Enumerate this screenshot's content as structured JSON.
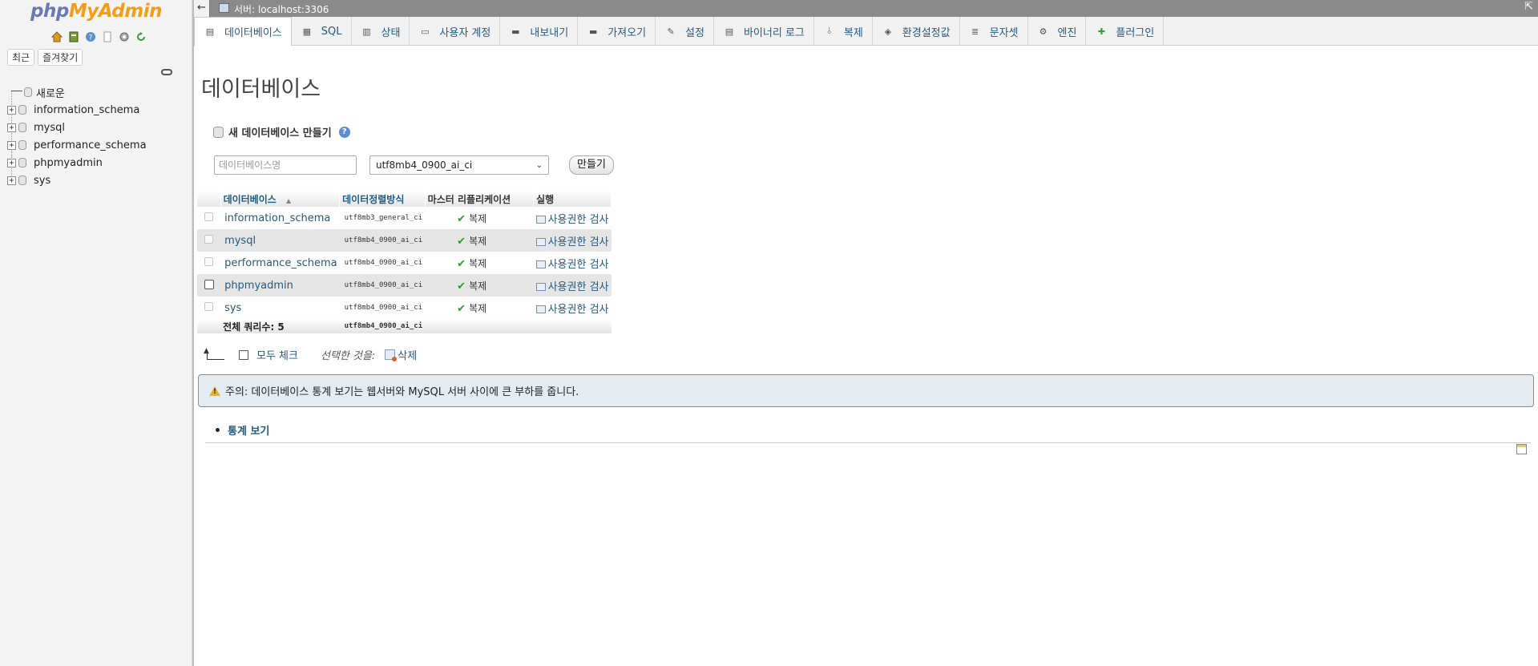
{
  "sidebar": {
    "logo": {
      "php": "php",
      "myadmin": "MyAdmin"
    },
    "nav_icons": [
      "home-icon",
      "database-icon",
      "help-icon",
      "docs-icon",
      "settings-icon",
      "reload-icon"
    ],
    "tabs": {
      "recent": "최근",
      "favorites": "즐겨찾기"
    },
    "tree": {
      "new_label": "새로운",
      "databases": [
        "information_schema",
        "mysql",
        "performance_schema",
        "phpmyadmin",
        "sys"
      ]
    }
  },
  "topbar": {
    "back": "←",
    "breadcrumb": "서버: localhost:3306",
    "collapse": "⇱"
  },
  "tabs": [
    {
      "label": "데이터베이스",
      "icon": "database-icon",
      "active": true
    },
    {
      "label": "SQL",
      "icon": "sql-icon"
    },
    {
      "label": "상태",
      "icon": "status-icon"
    },
    {
      "label": "사용자 계정",
      "icon": "users-icon"
    },
    {
      "label": "내보내기",
      "icon": "export-icon"
    },
    {
      "label": "가져오기",
      "icon": "import-icon"
    },
    {
      "label": "설정",
      "icon": "settings-icon"
    },
    {
      "label": "바이너리 로그",
      "icon": "binlog-icon"
    },
    {
      "label": "복제",
      "icon": "replication-icon"
    },
    {
      "label": "환경설정값",
      "icon": "variables-icon"
    },
    {
      "label": "문자셋",
      "icon": "charset-icon"
    },
    {
      "label": "엔진",
      "icon": "engine-icon"
    },
    {
      "label": "플러그인",
      "icon": "plugin-icon"
    }
  ],
  "main": {
    "title": "데이터베이스",
    "create": {
      "heading": "새 데이터베이스 만들기",
      "help": "?",
      "name_placeholder": "데이터베이스명",
      "collation_value": "utf8mb4_0900_ai_ci",
      "collation_chevron": "⌄",
      "button": "만들기"
    },
    "table": {
      "headers": {
        "database": "데이터베이스",
        "sort": "▲",
        "collation": "데이터정렬방식",
        "replication": "마스터 리플리케이션",
        "action": "실행"
      },
      "rows": [
        {
          "name": "information_schema",
          "collation": "utf8mb3_general_ci",
          "replication": "복제",
          "action": "사용권한 검사"
        },
        {
          "name": "mysql",
          "collation": "utf8mb4_0900_ai_ci",
          "replication": "복제",
          "action": "사용권한 검사"
        },
        {
          "name": "performance_schema",
          "collation": "utf8mb4_0900_ai_ci",
          "replication": "복제",
          "action": "사용권한 검사"
        },
        {
          "name": "phpmyadmin",
          "collation": "utf8mb4_0900_ai_ci",
          "replication": "복제",
          "action": "사용권한 검사"
        },
        {
          "name": "sys",
          "collation": "utf8mb4_0900_ai_ci",
          "replication": "복제",
          "action": "사용권한 검사"
        }
      ],
      "footer": {
        "total_label": "전체 쿼리수: 5",
        "collation": "utf8mb4_0900_ai_ci"
      },
      "check_glyph": "✔"
    },
    "bulk": {
      "check_all": "모두 체크",
      "with_selected": "선택한 것을:",
      "delete": "삭제"
    },
    "notice": {
      "text": "주의: 데이터베이스 통계 보기는 웹서버와 MySQL 서버 사이에 큰 부하를 줍니다.",
      "warn_glyph": "!"
    },
    "stats_link": "통계 보기"
  },
  "colors": {
    "link": "#235a81",
    "sidebar_bg": "#f3f3f3",
    "topbar_bg": "#8a8a8a",
    "notice_bg": "#e4ecf1",
    "logo_php": "#6a78b3",
    "logo_myadmin": "#f29d17"
  }
}
